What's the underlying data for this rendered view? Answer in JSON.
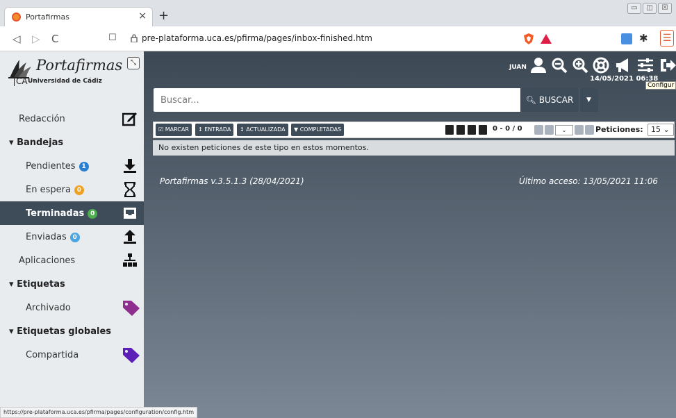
{
  "browser": {
    "tab_title": "Portafirmas",
    "tab_close": "×",
    "new_tab": "+",
    "url": "pre-plataforma.uca.es/pfirma/pages/inbox-finished.htm",
    "status_url": "https://pre-plataforma.uca.es/pfirma/pages/configuration/config.htm",
    "nav": {
      "back": "◁",
      "forward": "▷",
      "reload": "C",
      "bookmark": "☐"
    },
    "window_controls": [
      "▭",
      "◫",
      "☒"
    ]
  },
  "brand": {
    "name": "Portafirmas",
    "ca": "CA",
    "university": "Universidad de Cádiz"
  },
  "sidebar": {
    "items": [
      {
        "label": "Redacción",
        "kind": "item",
        "icon": "edit-icon"
      },
      {
        "label": "Bandejas",
        "kind": "section"
      },
      {
        "label": "Pendientes",
        "kind": "sub",
        "badge": "1",
        "badge_color": "#2a7fd4",
        "icon": "download-icon"
      },
      {
        "label": "En espera",
        "kind": "sub",
        "badge": "0",
        "badge_color": "#f0a020",
        "icon": "hourglass-icon"
      },
      {
        "label": "Terminadas",
        "kind": "sub",
        "badge": "0",
        "badge_color": "#4cae4c",
        "icon": "inbox-icon",
        "active": true
      },
      {
        "label": "Enviadas",
        "kind": "sub",
        "badge": "0",
        "badge_color": "#4aa5e0",
        "icon": "upload-icon"
      },
      {
        "label": "Aplicaciones",
        "kind": "item",
        "icon": "sitemap-icon"
      },
      {
        "label": "Etiquetas",
        "kind": "section"
      },
      {
        "label": "Archivado",
        "kind": "sub",
        "icon": "tag-icon",
        "tag_color": "#8e2f8f"
      },
      {
        "label": "Etiquetas globales",
        "kind": "section"
      },
      {
        "label": "Compartida",
        "kind": "sub",
        "icon": "tag-icon",
        "tag_color": "#5b1fb8"
      }
    ]
  },
  "header": {
    "user": "JUAN",
    "datetime": "14/05/2021 06:38",
    "tooltip": "Configur"
  },
  "search": {
    "placeholder": "Buscar...",
    "button": "BUSCAR"
  },
  "actions": {
    "marcar": "MARCAR",
    "entrada": "ENTRADA",
    "actualizada": "ACTUALIZADA",
    "completadas": "COMPLETADAS",
    "count": "0 - 0 / 0",
    "page_size_label": "Peticiones:",
    "page_size": "15"
  },
  "table": {
    "empty_message": "No existen peticiones de este tipo en estos momentos."
  },
  "footer": {
    "version": "Portafirmas v.3.5.1.3 (28/04/2021)",
    "last_access": "Último acceso: 13/05/2021 11:06"
  },
  "colors": {
    "sidebar_active": "#3e4c5a",
    "main_top": "#3c4955",
    "main_bottom": "#7b8794"
  }
}
